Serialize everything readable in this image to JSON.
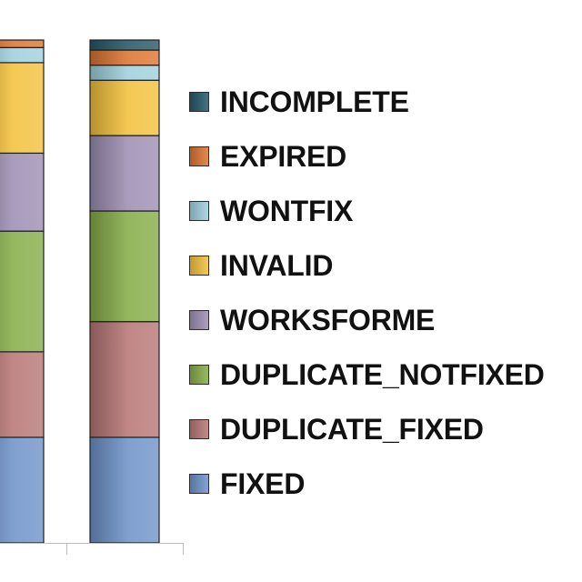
{
  "chart_data": {
    "type": "bar",
    "stacked": true,
    "ylim": [
      0,
      100
    ],
    "categories": [
      "",
      ""
    ],
    "series": [
      {
        "name": "FIXED",
        "color": "#6f93c9",
        "values": [
          21,
          21
        ]
      },
      {
        "name": "DUPLICATE_FIXED",
        "color": "#b77775",
        "values": [
          17,
          23
        ]
      },
      {
        "name": "DUPLICATE_NOTFIXED",
        "color": "#86ad49",
        "values": [
          24,
          22
        ]
      },
      {
        "name": "WORKSFORME",
        "color": "#9d8fb3",
        "values": [
          15.5,
          15
        ]
      },
      {
        "name": "INVALID",
        "color": "#f3c13d",
        "values": [
          18,
          11
        ]
      },
      {
        "name": "WONTFIX",
        "color": "#9fd0dd",
        "values": [
          3,
          3
        ]
      },
      {
        "name": "EXPIRED",
        "color": "#dd7431",
        "values": [
          1.5,
          3
        ]
      },
      {
        "name": "INCOMPLETE",
        "color": "#255869",
        "values": [
          0,
          2
        ]
      }
    ],
    "legend_position": "right",
    "grid": false
  },
  "legend": {
    "order": [
      "INCOMPLETE",
      "EXPIRED",
      "WONTFIX",
      "INVALID",
      "WORKSFORME",
      "DUPLICATE_NOTFIXED",
      "DUPLICATE_FIXED",
      "FIXED"
    ]
  }
}
